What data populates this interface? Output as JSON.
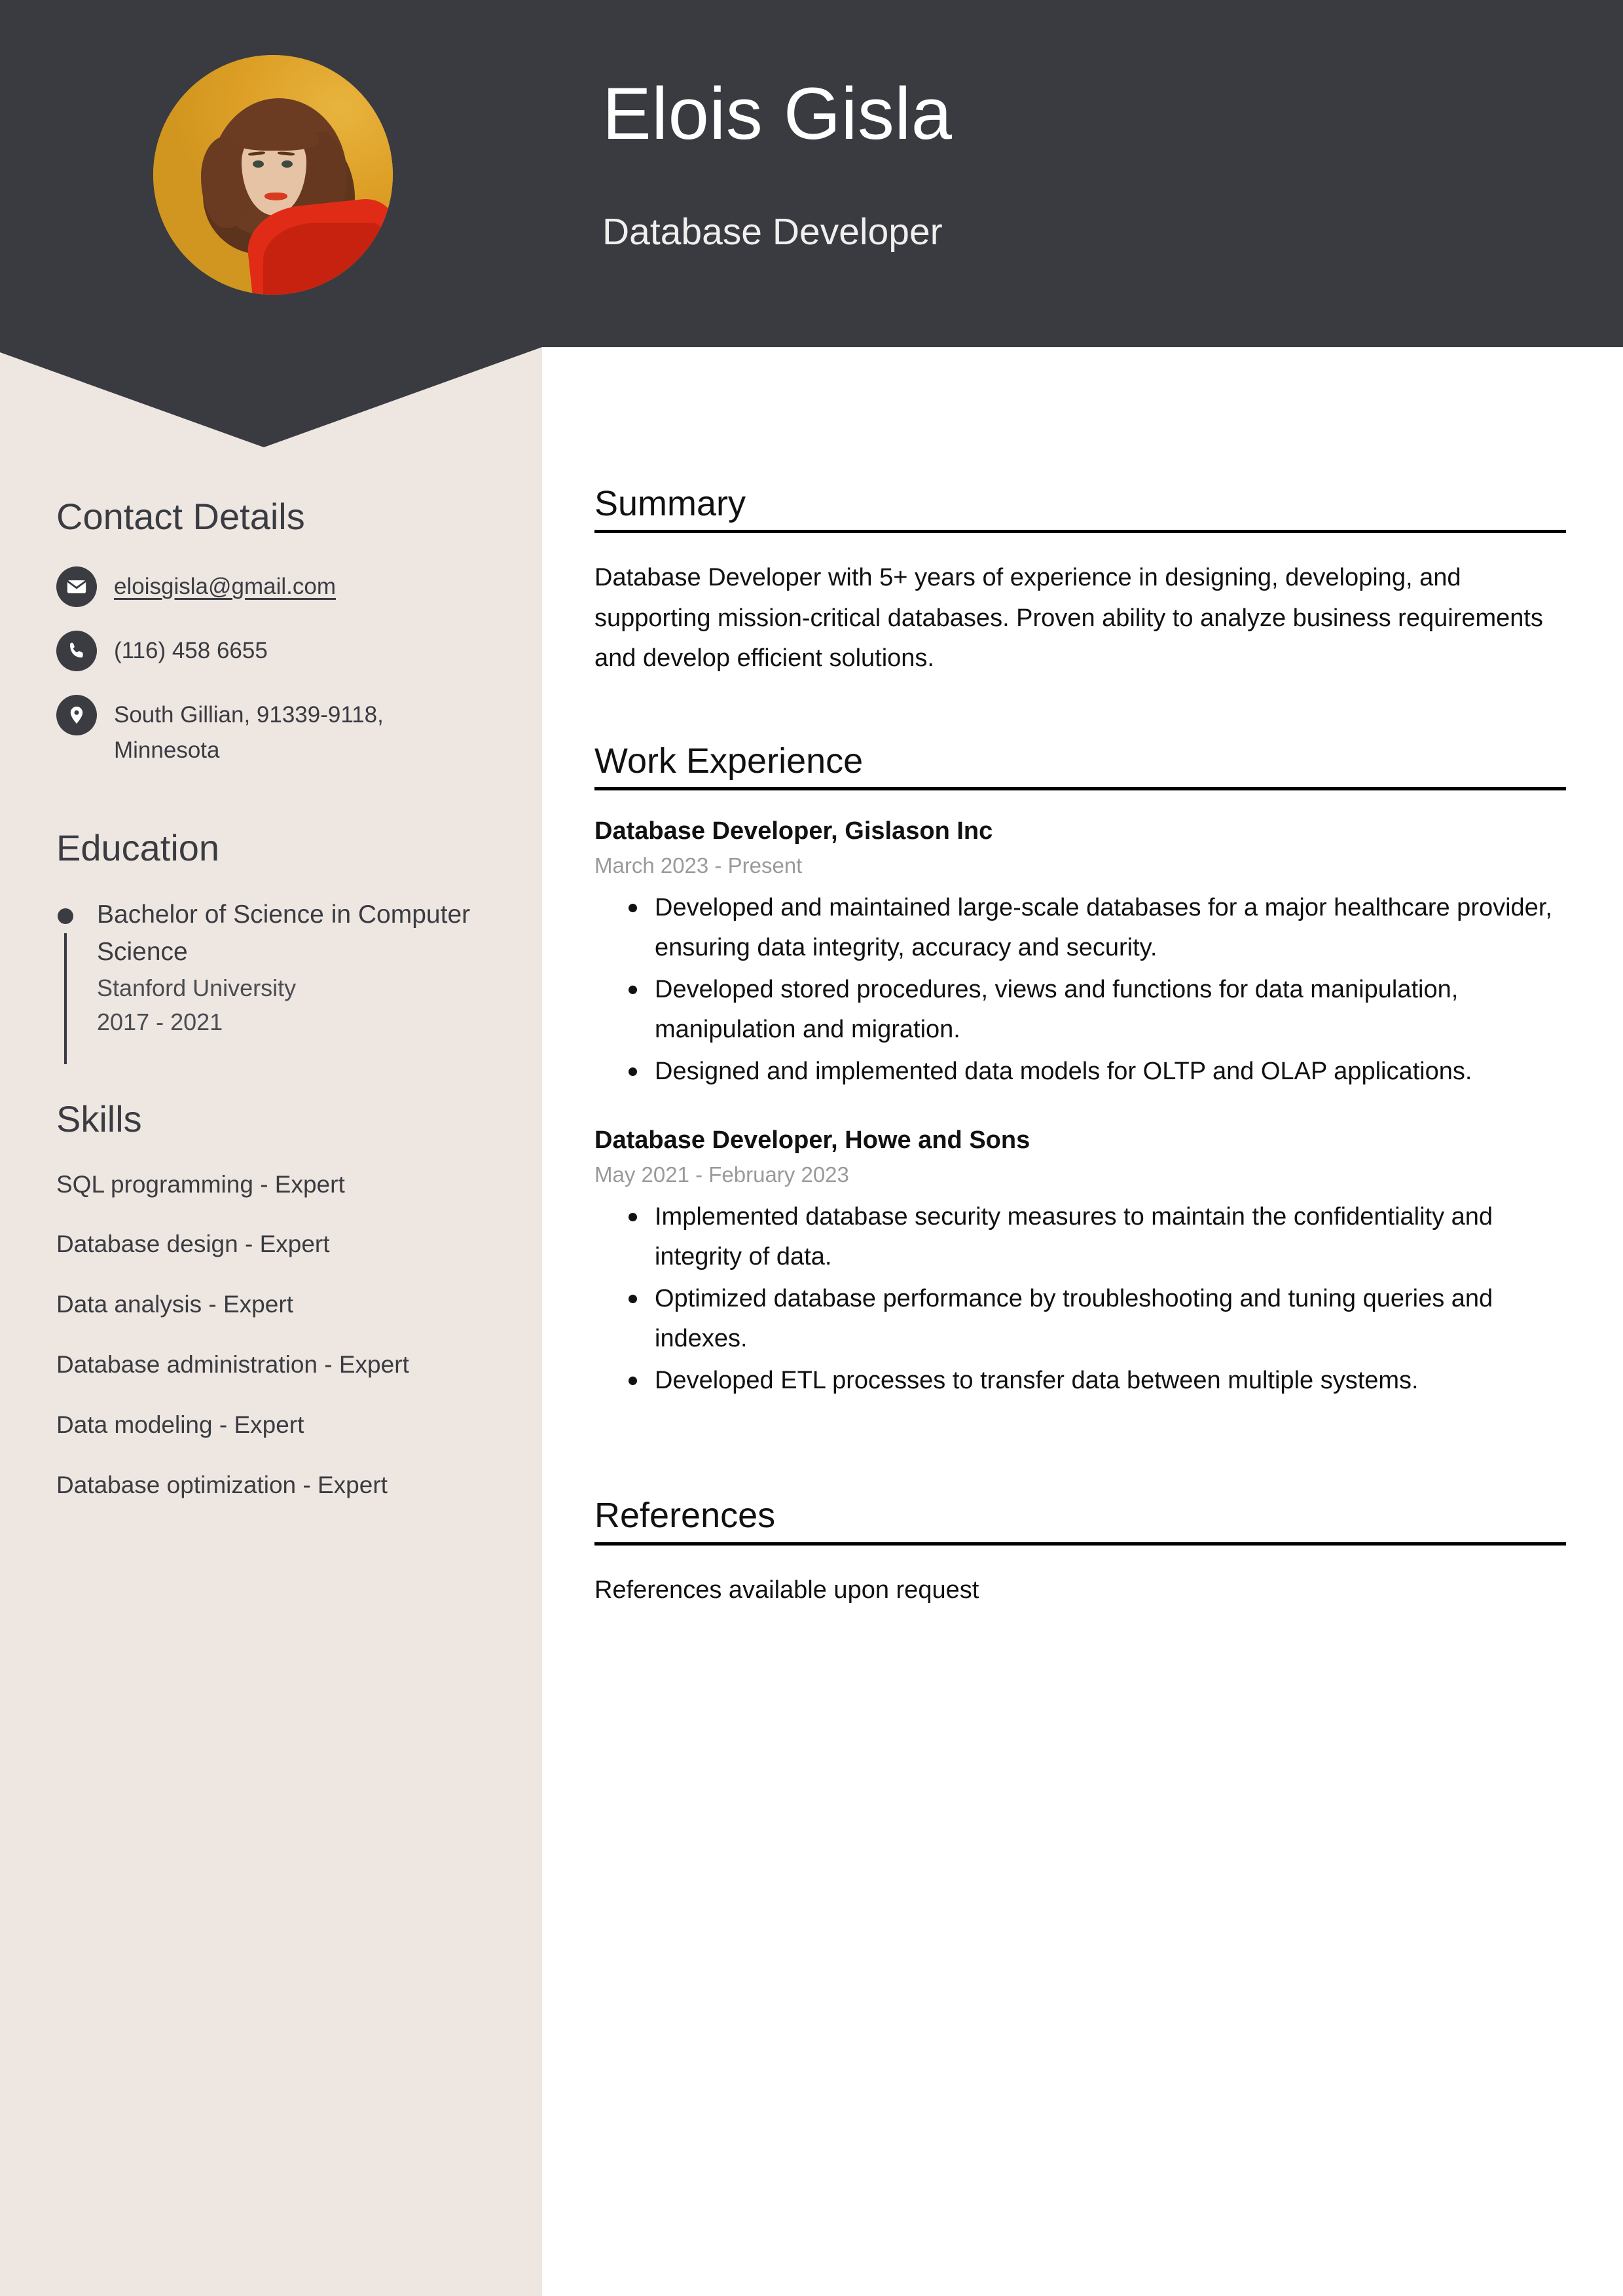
{
  "theme": {
    "header_bg": "#393B41",
    "sidebar_bg": "#EEE6E1",
    "main_bg": "#FFFFFF",
    "accent_avatar_bg": "#E2A72E",
    "rule_color": "#000000",
    "muted_text": "#9A9A9A"
  },
  "header": {
    "name": "Elois Gisla",
    "job_title": "Database Developer",
    "avatar_alt": "portrait-photo"
  },
  "sidebar": {
    "contact": {
      "heading": "Contact Details",
      "items": [
        {
          "icon": "envelope-icon",
          "value": "eloisgisla@gmail.com",
          "is_link": true
        },
        {
          "icon": "phone-icon",
          "value": "(116) 458 6655",
          "is_link": false
        },
        {
          "icon": "map-pin-icon",
          "value": "South Gillian, 91339-9118, Minnesota",
          "is_link": false
        }
      ]
    },
    "education": {
      "heading": "Education",
      "entries": [
        {
          "degree": "Bachelor of Science in Computer Science",
          "school": "Stanford University",
          "dates": "2017 - 2021"
        }
      ]
    },
    "skills": {
      "heading": "Skills",
      "items": [
        "SQL programming - Expert",
        "Database design - Expert",
        "Data analysis - Expert",
        "Database administration - Expert",
        "Data modeling - Expert",
        "Database optimization - Expert"
      ]
    }
  },
  "main": {
    "summary": {
      "heading": "Summary",
      "text": "Database Developer with 5+ years of experience in designing, developing, and supporting mission-critical databases. Proven ability to analyze business requirements and develop efficient solutions."
    },
    "work_experience": {
      "heading": "Work Experience",
      "jobs": [
        {
          "title": "Database Developer, Gislason Inc",
          "dates": "March 2023 - Present",
          "bullets": [
            "Developed and maintained large-scale databases for a major healthcare provider, ensuring data integrity, accuracy and security.",
            "Developed stored procedures, views and functions for data manipulation, manipulation and migration.",
            "Designed and implemented data models for OLTP and OLAP applications."
          ]
        },
        {
          "title": "Database Developer, Howe and Sons",
          "dates": "May 2021 - February 2023",
          "bullets": [
            "Implemented database security measures to maintain the confidentiality and integrity of data.",
            "Optimized database performance by troubleshooting and tuning queries and indexes.",
            "Developed ETL processes to transfer data between multiple systems."
          ]
        }
      ]
    },
    "references": {
      "heading": "References",
      "text": "References available upon request"
    }
  }
}
